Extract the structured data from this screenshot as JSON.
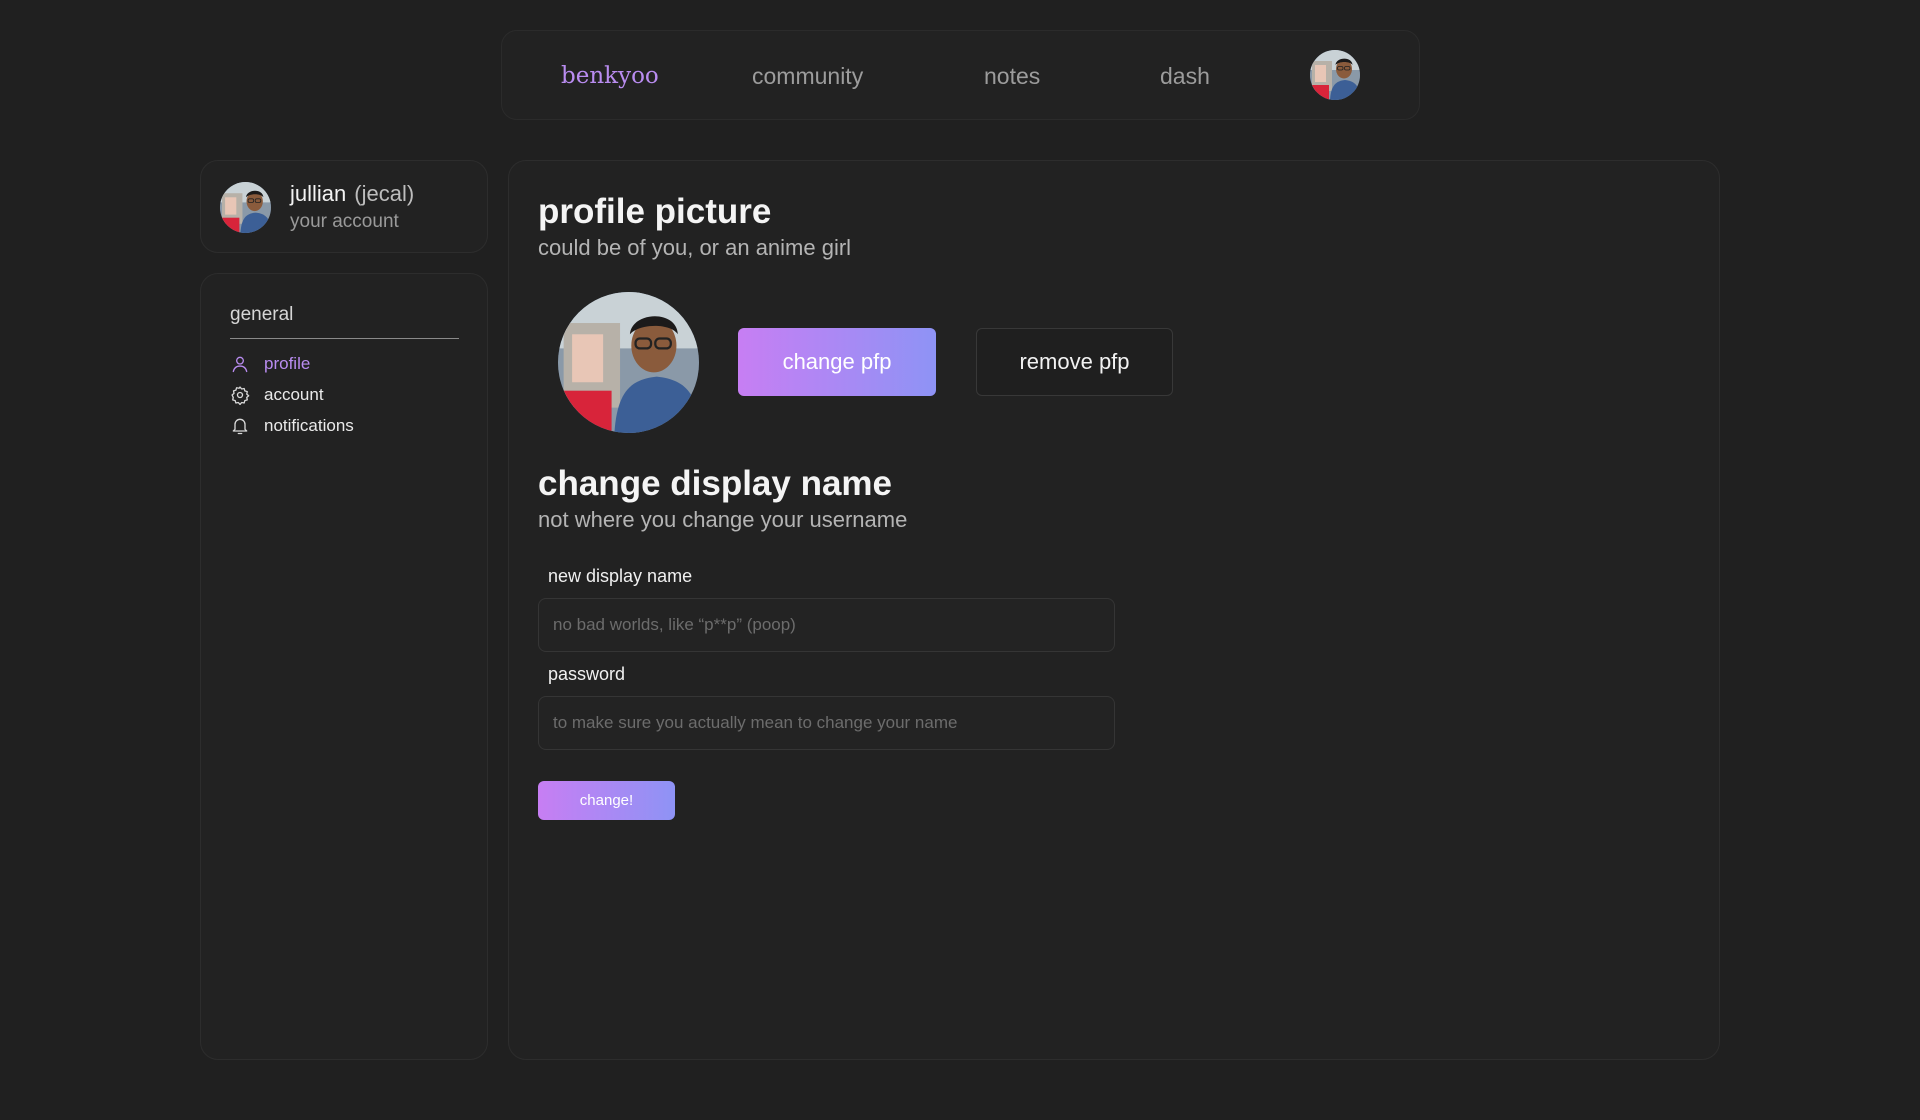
{
  "topnav": {
    "brand": "benkyoo",
    "links": [
      "community",
      "notes",
      "dash"
    ]
  },
  "user": {
    "name": "jullian",
    "handle": "(jecal)",
    "subtitle": "your account"
  },
  "sidebar": {
    "section_title": "general",
    "items": [
      {
        "label": "profile",
        "icon": "user-icon",
        "active": true
      },
      {
        "label": "account",
        "icon": "gear-icon",
        "active": false
      },
      {
        "label": "notifications",
        "icon": "bell-icon",
        "active": false
      }
    ]
  },
  "profile_picture": {
    "title": "profile picture",
    "subtitle": "could be of you, or an anime girl",
    "change_label": "change pfp",
    "remove_label": "remove pfp"
  },
  "display_name": {
    "title": "change display name",
    "subtitle": "not where you change your username",
    "name_label": "new display name",
    "name_placeholder": "no bad worlds, like “p**p” (poop)",
    "password_label": "password",
    "password_placeholder": "to make sure you actually mean to change your name",
    "submit_label": "change!"
  },
  "colors": {
    "accent": "#b98cf0",
    "gradient_start": "#c77ef3",
    "gradient_end": "#8e93f5",
    "background": "#202020"
  }
}
